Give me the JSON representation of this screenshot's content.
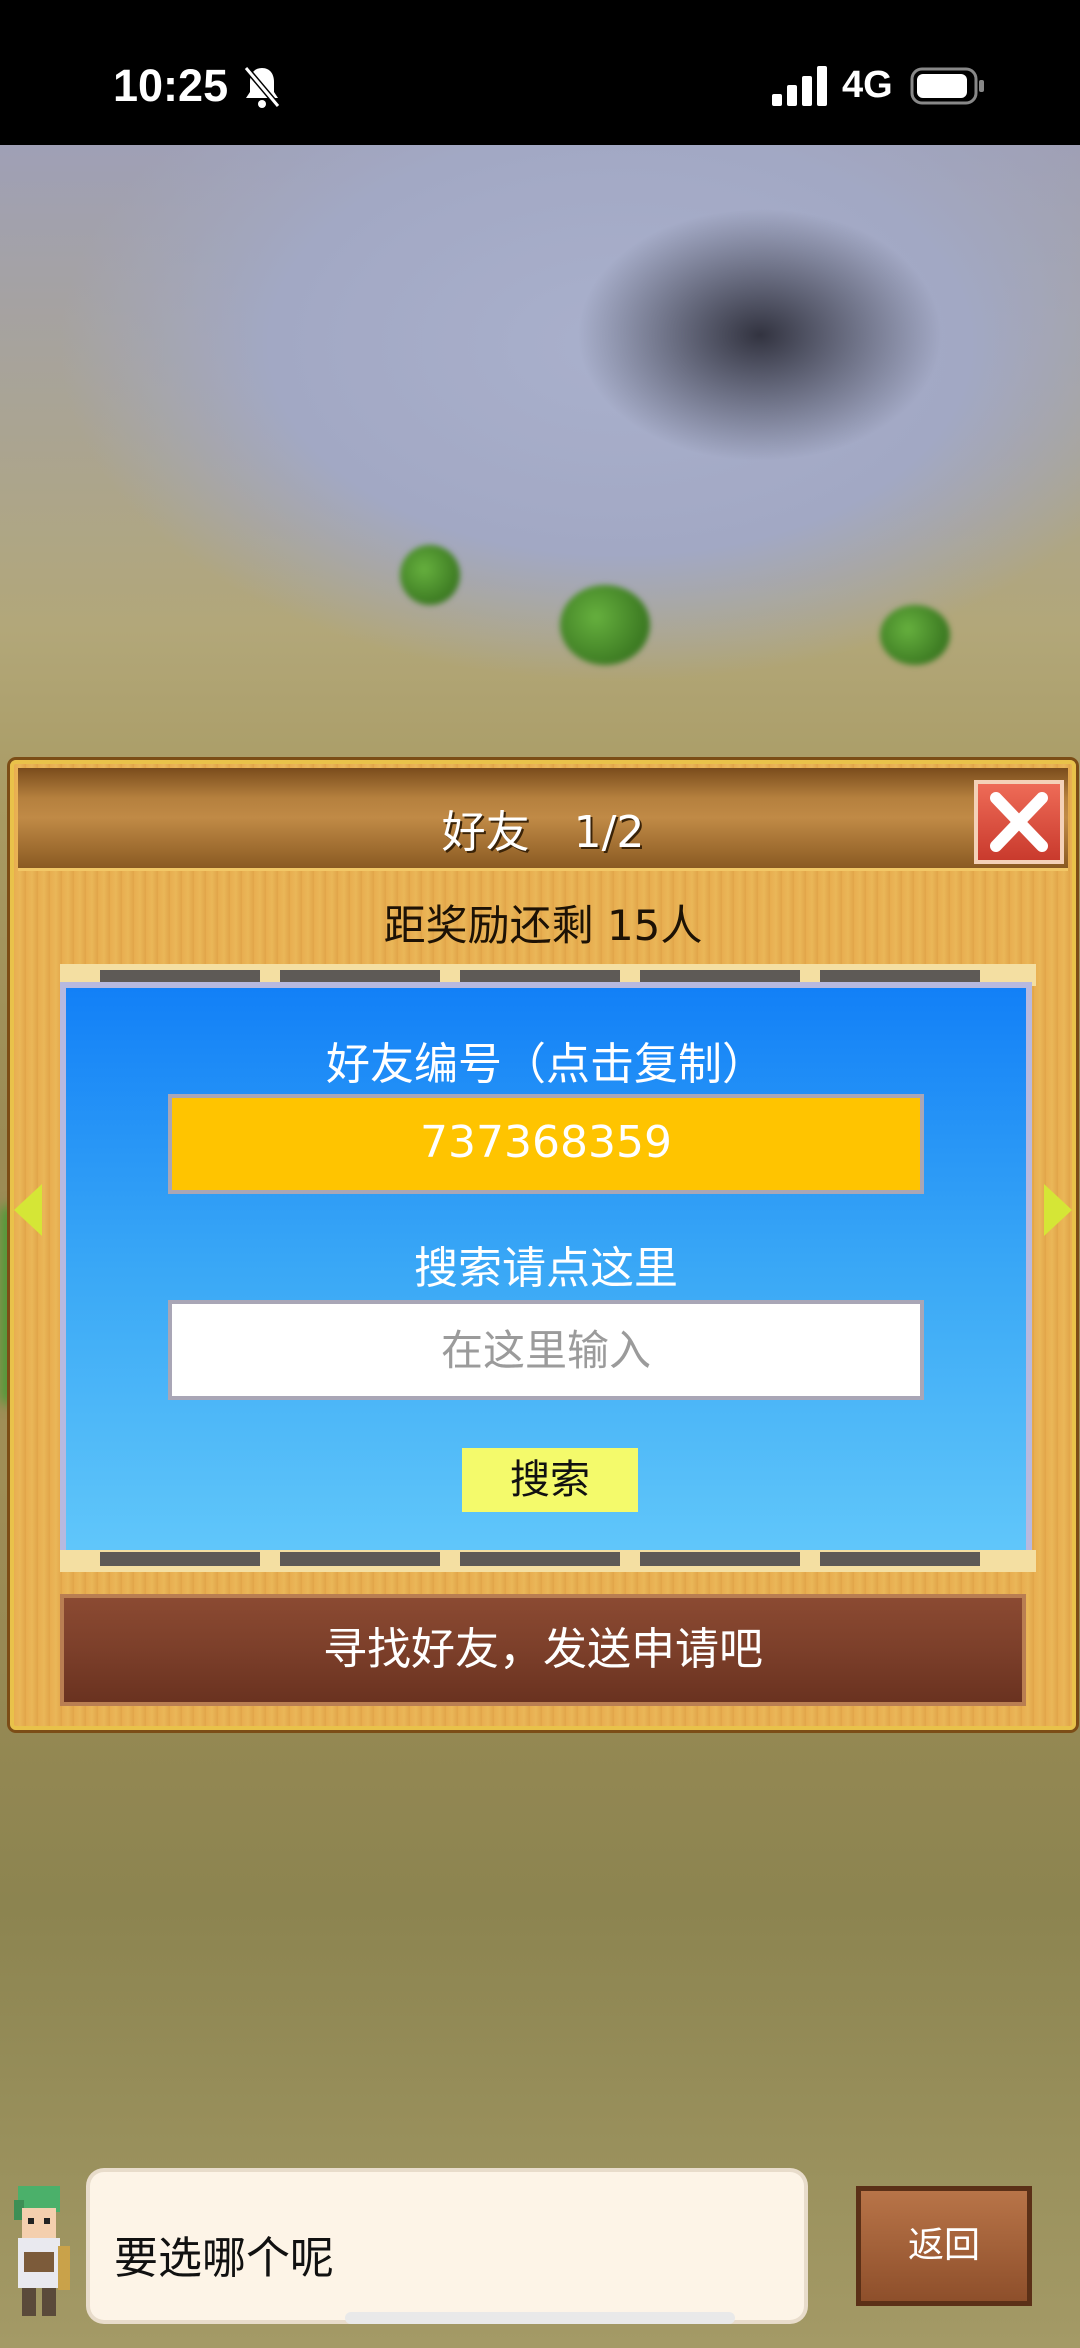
{
  "status_bar": {
    "time": "10:25",
    "network": "4G",
    "icons": [
      "bell-slash-icon",
      "signal-icon",
      "battery-icon"
    ]
  },
  "dialog": {
    "title": "好友　1/2",
    "reward_text": "距奖励还剩 15人",
    "friend_id_label": "好友编号（点击复制）",
    "friend_id": "737368359",
    "search_label": "搜索请点这里",
    "search_placeholder": "在这里输入",
    "search_button": "搜索",
    "find_friends_button": "寻找好友，发送申请吧"
  },
  "bottom": {
    "speech_text": "要选哪个呢",
    "back_button": "返回"
  },
  "colors": {
    "panel_blue": "#1280f7",
    "id_box_yellow": "#ffc400",
    "search_button": "#f4fa6b",
    "close_red": "#d94a3b",
    "find_button_brown": "#7c3f2a"
  }
}
